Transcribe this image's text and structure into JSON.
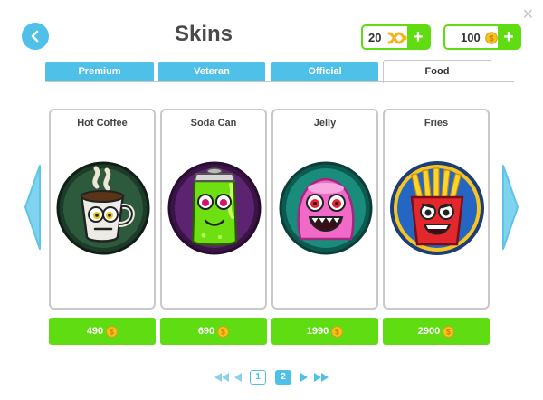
{
  "header": {
    "title": "Skins",
    "close_glyph": "✕",
    "back_icon": "back-arrow-icon"
  },
  "currencies": [
    {
      "name": "dna",
      "value": "20",
      "icon": "dna-icon",
      "add_label": "+"
    },
    {
      "name": "coins",
      "value": "100",
      "icon": "coin-icon",
      "add_label": "+"
    }
  ],
  "tabs": [
    {
      "label": "Premium",
      "active": false
    },
    {
      "label": "Veteran",
      "active": false
    },
    {
      "label": "Official",
      "active": false
    },
    {
      "label": "Food",
      "active": true
    }
  ],
  "skins": [
    {
      "name": "Hot Coffee",
      "price": "490",
      "art": "coffee-cup-monster"
    },
    {
      "name": "Soda Can",
      "price": "690",
      "art": "soda-can-monster"
    },
    {
      "name": "Jelly",
      "price": "1990",
      "art": "pink-jelly-monster"
    },
    {
      "name": "Fries",
      "price": "2900",
      "art": "fries-monster"
    }
  ],
  "pagination": {
    "pages": [
      "1",
      "2"
    ],
    "current_page": "2"
  },
  "colors": {
    "accent_blue": "#4fc1e9",
    "buy_green": "#5fdc12",
    "coin_gold": "#f7c21b",
    "card_border": "#c9c9c9"
  }
}
